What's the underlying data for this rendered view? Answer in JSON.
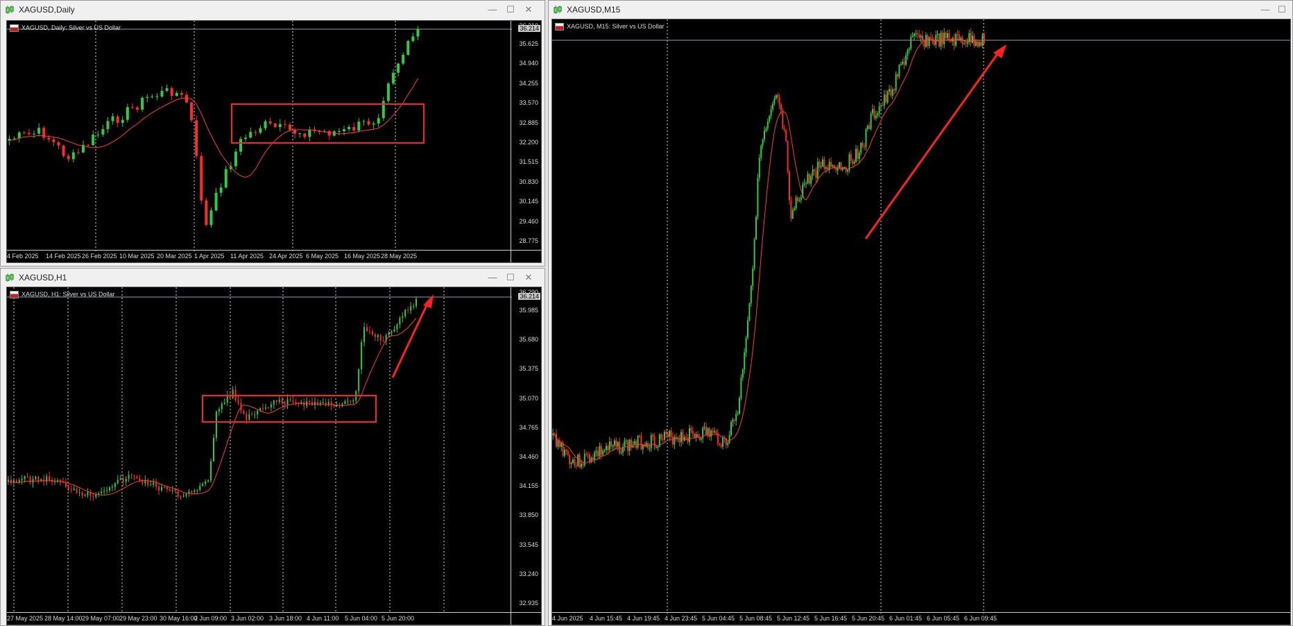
{
  "colors": {
    "bull": "#2ecc40",
    "bear": "#ff2a2a",
    "ma": "#ff3b30",
    "grid": "#d8d8d8",
    "box": "#ff2020"
  },
  "windows": {
    "daily": {
      "title": "XAGUSD,Daily",
      "header": "XAGUSD, Daily:  Silver vs US Dollar",
      "min_icon": "minimize-icon",
      "max_icon": "maximize-icon",
      "close_icon": "close-icon",
      "price_labels": [
        "35.625",
        "34.940",
        "34.255",
        "33.570",
        "32.885",
        "32.200",
        "31.515",
        "30.830",
        "30.145",
        "29.460",
        "28.775"
      ],
      "current_price": "36.214",
      "top_price": "36.310",
      "time_labels": [
        "4 Feb 2025",
        "14 Feb 2025",
        "26 Feb 2025",
        "10 Mar 2025",
        "20 Mar 2025",
        "1 Apr 2025",
        "11 Apr 2025",
        "24 Apr 2025",
        "6 May 2025",
        "16 May 2025",
        "28 May 2025"
      ]
    },
    "h1": {
      "title": "XAGUSD,H1",
      "header": "XAGUSD, H1:  Silver vs US Dollar",
      "price_labels": [
        "35.985",
        "35.680",
        "35.375",
        "35.070",
        "34.765",
        "34.460",
        "34.155",
        "33.850",
        "33.545",
        "33.240",
        "32.935"
      ],
      "current_price": "36.214",
      "top_price": "36.290",
      "time_labels": [
        "27 May 2025",
        "28 May 14:00",
        "29 May 07:00",
        "29 May 23:00",
        "30 May 16:00",
        "2 Jun 09:00",
        "3 Jun 02:00",
        "3 Jun 18:00",
        "4 Jun 11:00",
        "5 Jun 04:00",
        "5 Jun 20:00"
      ]
    },
    "m15": {
      "title": "XAGUSD,M15",
      "header": "XAGUSD, M15:  Silver vs US Dollar",
      "time_labels": [
        "4 Jun 2025",
        "4 Jun 15:45",
        "4 Jun 19:45",
        "4 Jun 23:45",
        "5 Jun 04:45",
        "5 Jun 08:45",
        "5 Jun 12:45",
        "5 Jun 16:45",
        "5 Jun 20:45",
        "6 Jun 01:45",
        "6 Jun 05:45",
        "6 Jun 09:45"
      ]
    }
  }
}
